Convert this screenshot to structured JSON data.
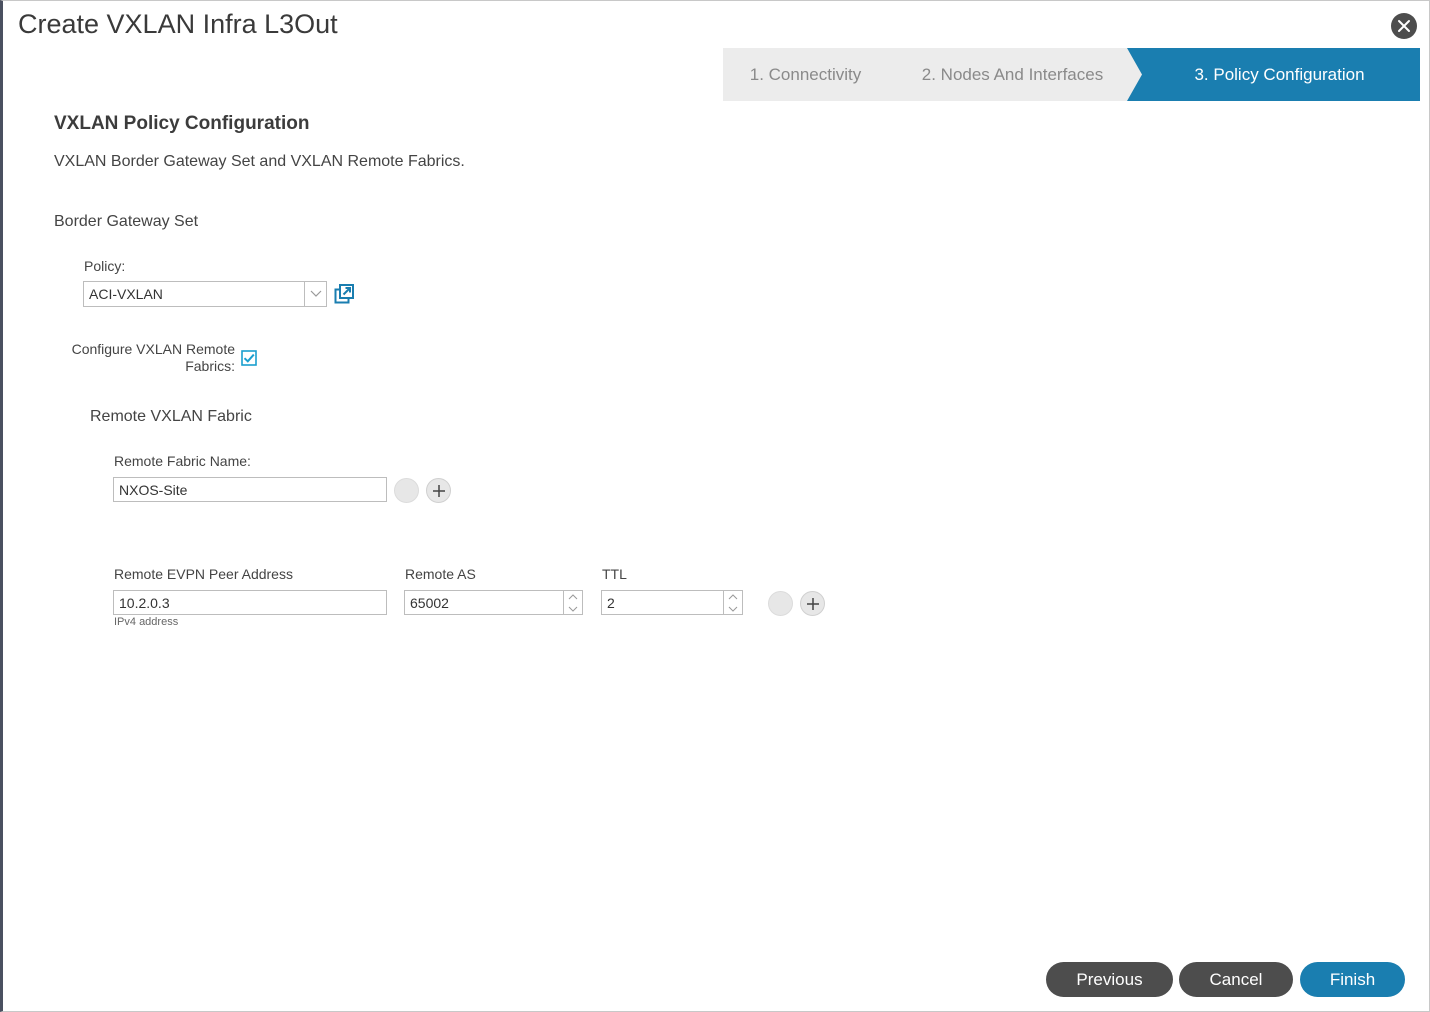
{
  "dialog": {
    "title": "Create VXLAN Infra L3Out"
  },
  "wizard": {
    "steps": [
      {
        "label": "1. Connectivity",
        "active": false
      },
      {
        "label": "2. Nodes And Interfaces",
        "active": false
      },
      {
        "label": "3. Policy Configuration",
        "active": true
      }
    ]
  },
  "section": {
    "title": "VXLAN Policy Configuration",
    "description": "VXLAN Border Gateway Set and VXLAN Remote Fabrics."
  },
  "border_gateway_set": {
    "title": "Border Gateway Set",
    "policy_label": "Policy:",
    "policy_value": "ACI-VXLAN"
  },
  "configure_remote": {
    "label_line1": "Configure VXLAN Remote",
    "label_line2": "Fabrics:",
    "checked": true
  },
  "remote_fabric": {
    "title": "Remote VXLAN Fabric",
    "name_label": "Remote Fabric Name:",
    "name_value": "NXOS-Site",
    "peer_label": "Remote EVPN Peer Address",
    "peer_value": "10.2.0.3",
    "peer_hint": "IPv4 address",
    "as_label": "Remote AS",
    "as_value": "65002",
    "ttl_label": "TTL",
    "ttl_value": "2"
  },
  "footer": {
    "previous": "Previous",
    "cancel": "Cancel",
    "finish": "Finish"
  },
  "colors": {
    "accent": "#1a7eb0",
    "button_gray": "#4d4d4d",
    "step_inactive": "#ececec"
  }
}
